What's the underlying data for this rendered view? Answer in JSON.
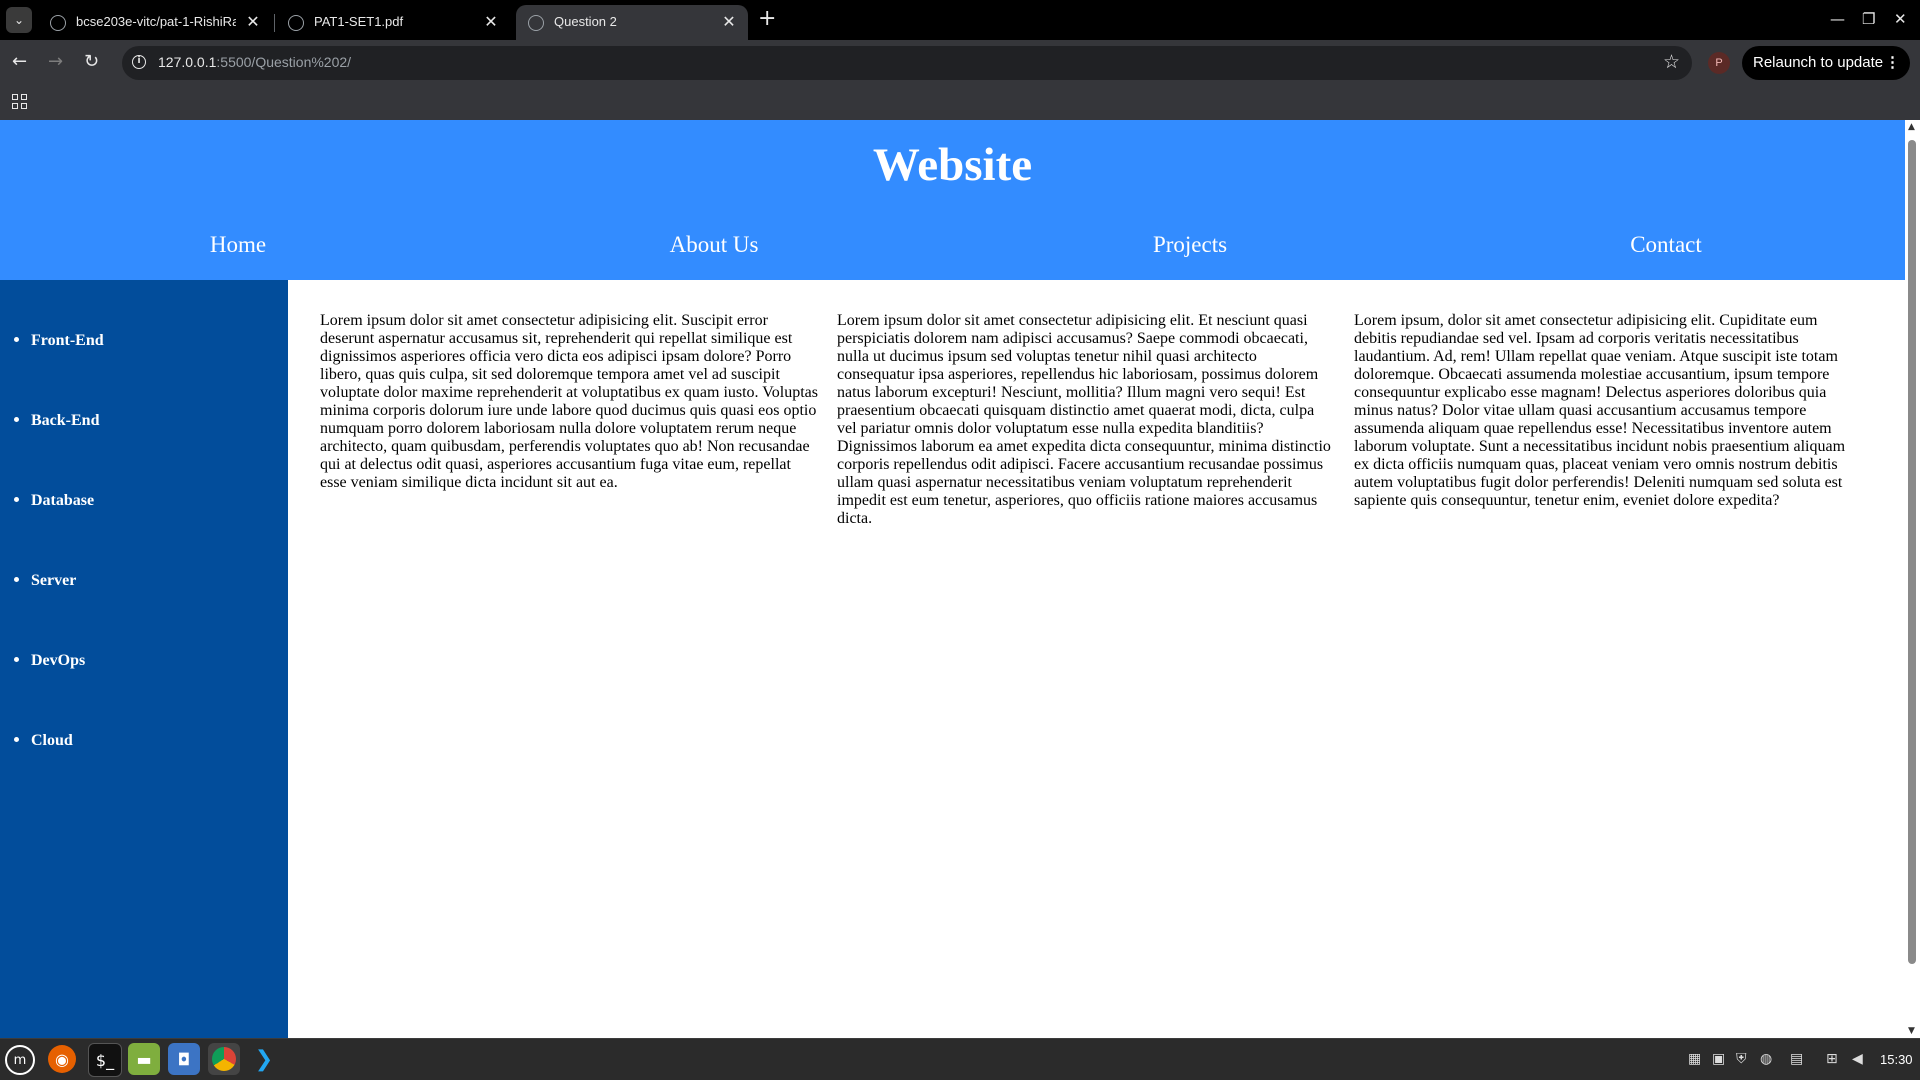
{
  "browser": {
    "tabs": [
      {
        "title": "bcse203e-vitc/pat-1-RishiRa",
        "active": false
      },
      {
        "title": "PAT1-SET1.pdf",
        "active": false
      },
      {
        "title": "Question 2",
        "active": true
      }
    ],
    "url_host": "127.0.0.1",
    "url_path": ":5500/Question%202/",
    "profile_initial": "P",
    "relaunch_label": "Relaunch to update"
  },
  "page": {
    "title": "Website",
    "nav": [
      "Home",
      "About Us",
      "Projects",
      "Contact"
    ],
    "sidebar": [
      "Front-End",
      "Back-End",
      "Database",
      "Server",
      "DevOps",
      "Cloud"
    ],
    "columns": [
      "Lorem ipsum dolor sit amet consectetur adipisicing elit. Suscipit error deserunt aspernatur accusamus sit, reprehenderit qui repellat similique est dignissimos asperiores officia vero dicta eos adipisci ipsam dolore? Porro libero, quas quis culpa, sit sed doloremque tempora amet vel ad suscipit voluptate dolor maxime reprehenderit at voluptatibus ex quam iusto. Voluptas minima corporis dolorum iure unde labore quod ducimus quis quasi eos optio numquam porro dolorem laboriosam nulla dolore voluptatem rerum neque architecto, quam quibusdam, perferendis voluptates quo ab! Non recusandae qui at delectus odit quasi, asperiores accusantium fuga vitae eum, repellat esse veniam similique dicta incidunt sit aut ea.",
      "Lorem ipsum dolor sit amet consectetur adipisicing elit. Et nesciunt quasi perspiciatis dolorem nam adipisci accusamus? Saepe commodi obcaecati, nulla ut ducimus ipsum sed voluptas tenetur nihil quasi architecto consequatur ipsa asperiores, repellendus hic laboriosam, possimus dolorem natus laborum excepturi! Nesciunt, mollitia? Illum magni vero sequi! Est praesentium obcaecati quisquam distinctio amet quaerat modi, dicta, culpa vel pariatur omnis dolor voluptatum esse nulla expedita blanditiis? Dignissimos laborum ea amet expedita dicta consequuntur, minima distinctio corporis repellendus odit adipisci. Facere accusantium recusandae possimus ullam quasi aspernatur necessitatibus veniam voluptatum reprehenderit impedit est eum tenetur, asperiores, quo officiis ratione maiores accusamus dicta.",
      "Lorem ipsum, dolor sit amet consectetur adipisicing elit. Cupiditate eum debitis repudiandae sed vel. Ipsam ad corporis veritatis necessitatibus laudantium. Ad, rem! Ullam repellat quae veniam. Atque suscipit iste totam doloremque. Obcaecati assumenda molestiae accusantium, ipsum tempore consequuntur explicabo esse magnam! Delectus asperiores doloribus quia minus natus? Dolor vitae ullam quasi accusantium accusamus tempore assumenda aliquam quae repellendus esse! Necessitatibus inventore autem laborum voluptate. Sunt a necessitatibus incidunt nobis praesentium aliquam ex dicta officiis numquam quas, placeat veniam vero omnis nostrum debitis autem voluptatibus fugit dolor perferendis! Deleniti numquam sed soluta est sapiente quis consequuntur, tenetur enim, eveniet dolore expedita?"
    ]
  },
  "colors": {
    "header_bg": "#338cff",
    "sidebar_bg": "#024d9b"
  },
  "taskbar": {
    "apps": [
      "mint-menu-icon",
      "firefox-icon",
      "terminal-icon",
      "files-icon",
      "screenshot-icon",
      "chrome-icon",
      "vscode-icon"
    ],
    "clock": "15:30"
  }
}
